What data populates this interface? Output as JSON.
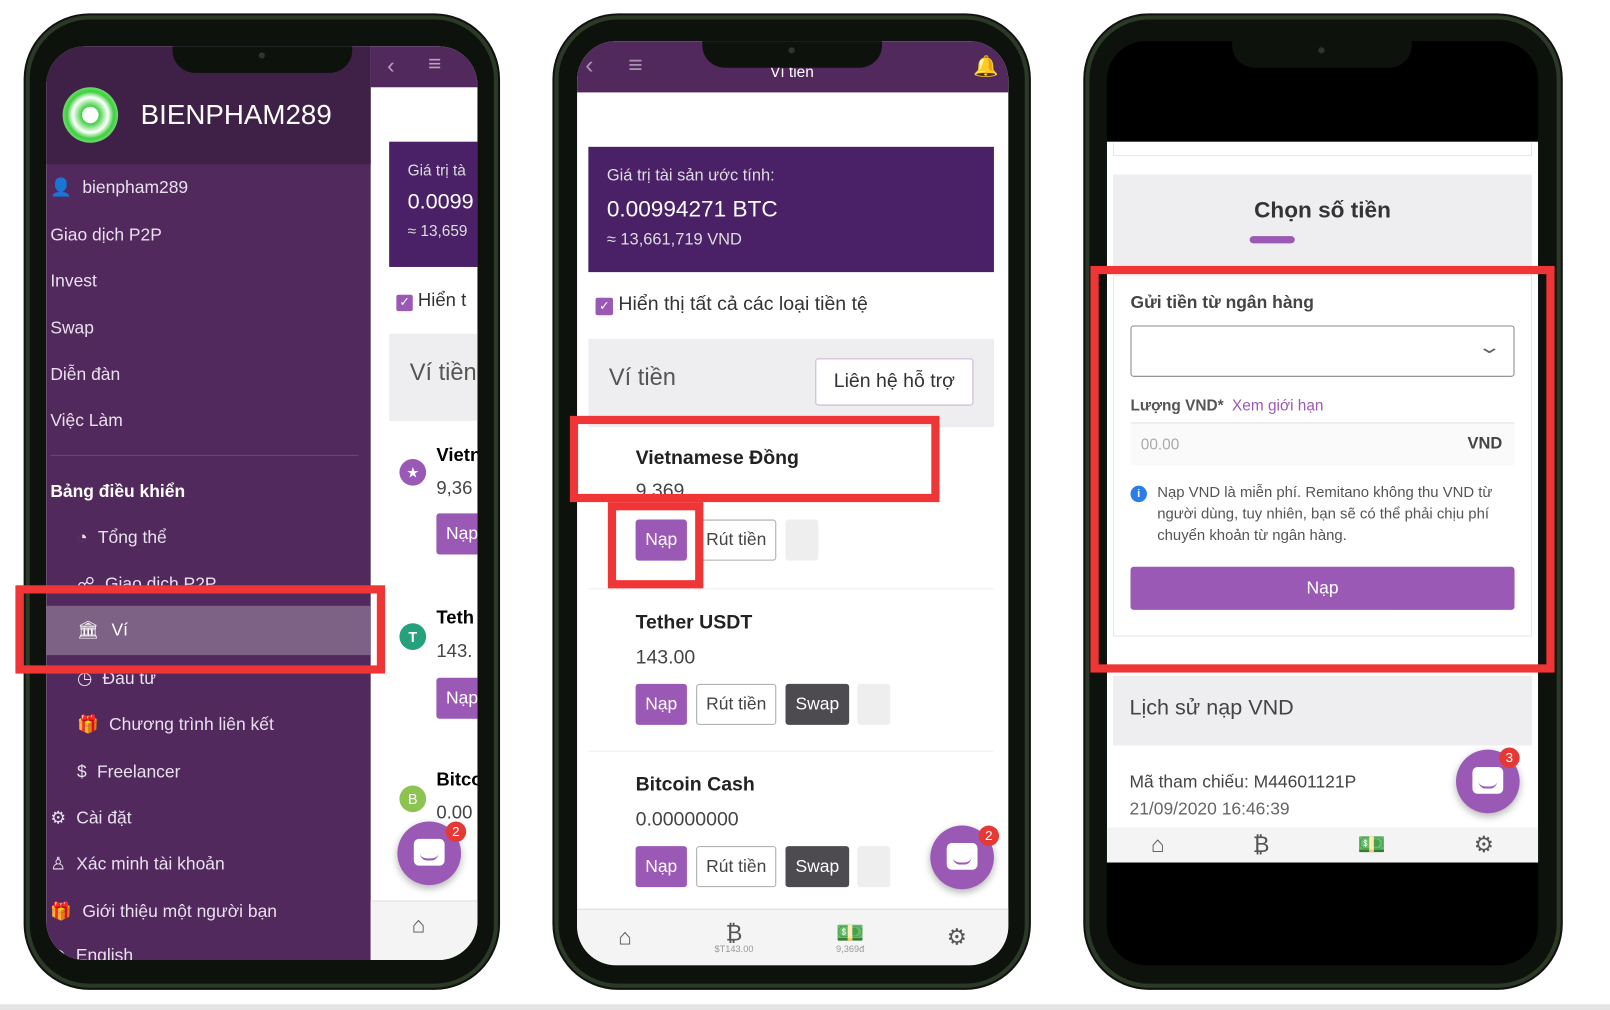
{
  "phone1": {
    "brand": "BIENPHAM289",
    "user": "bienpham289",
    "menu": [
      "Giao dịch P2P",
      "Invest",
      "Swap",
      "Diễn đàn",
      "Việc Làm"
    ],
    "dashboard_heading": "Bảng điều khiển",
    "dashboard_items": [
      "Tổng thể",
      "Giao dịch P2P",
      "Ví",
      "Đầu tư",
      "Chương trình liên kết",
      "Freelancer"
    ],
    "bottom_items": [
      "Cài đặt",
      "Xác minh tài khoản",
      "Giới thiệu một người bạn",
      "English"
    ],
    "peek": {
      "label": "Giá trị tà",
      "btc": "0.0099",
      "vnd": "≈ 13,659",
      "show": "Hiển t",
      "wallet": "Ví tiền",
      "items": [
        {
          "name": "Vietn",
          "amount": "9,36"
        },
        {
          "name": "Teth",
          "amount": "143."
        },
        {
          "name": "Bitco",
          "amount": "0.00"
        }
      ],
      "nap": "Nạp",
      "chat_badge": "2"
    }
  },
  "phone2": {
    "title": "Ví tiền",
    "asset_label": "Giá trị tài sản ước tính:",
    "asset_btc": "0.00994271 BTC",
    "asset_vnd": "≈ 13,661,719 VND",
    "show_all": "Hiển thị tất cả các loại tiền tệ",
    "wallet_heading": "Ví tiền",
    "support_button": "Liên hệ hỗ trợ",
    "wallets": [
      {
        "name": "Vietnamese Đồng",
        "amount": "9,369",
        "nap": "Nạp",
        "rut": "Rút tiền"
      },
      {
        "name": "Tether USDT",
        "amount": "143.00",
        "nap": "Nạp",
        "rut": "Rút tiền",
        "swap": "Swap"
      },
      {
        "name": "Bitcoin Cash",
        "amount": "0.00000000",
        "nap": "Nạp",
        "rut": "Rút tiền",
        "swap": "Swap"
      }
    ],
    "chat_badge": "2",
    "nav": {
      "btc_sub": "$T143.00",
      "cash_sub": "9,369đ"
    }
  },
  "phone3": {
    "step_title": "Chọn số tiền",
    "bank_label": "Gửi tiền từ ngân hàng",
    "bank_select_value": "",
    "amount_label": "Lượng VND*",
    "limit_link": "Xem giới hạn",
    "amount_placeholder": "00.00",
    "currency": "VND",
    "info": "Nạp VND là miễn phí. Remitano không thu VND từ người dùng, tuy nhiên, bạn sẽ có thể phải chịu phí chuyển khoản từ ngân hàng.",
    "submit": "Nạp",
    "history_title": "Lịch sử nạp VND",
    "ref": "Mã tham chiếu: M44601121P",
    "date": "21/09/2020 16:46:39",
    "chat_badge": "3"
  },
  "colors": {
    "purple": "#9b59b6",
    "sidebar": "#52295c",
    "card": "#4a2066",
    "highlight": "#ef3535"
  }
}
